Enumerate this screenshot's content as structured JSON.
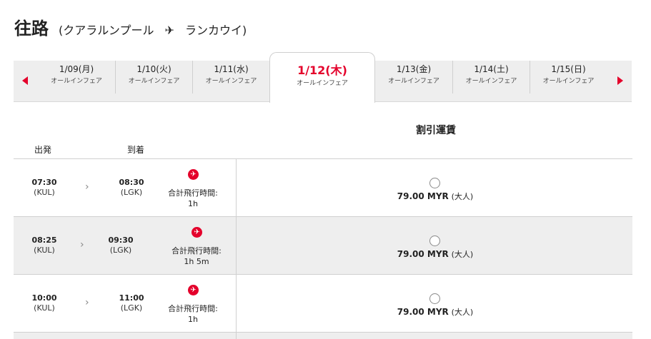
{
  "header": {
    "title": "往路",
    "route_open": "(クアラルンプール",
    "plane_glyph": "✈",
    "route_close": "ランカウイ)"
  },
  "dates": [
    {
      "date": "1/09(月)",
      "fare": "オールインフェア"
    },
    {
      "date": "1/10(火)",
      "fare": "オールインフェア"
    },
    {
      "date": "1/11(水)",
      "fare": "オールインフェア"
    },
    {
      "date": "1/12(木)",
      "fare": "オールインフェア"
    },
    {
      "date": "1/13(金)",
      "fare": "オールインフェア"
    },
    {
      "date": "1/14(土)",
      "fare": "オールインフェア"
    },
    {
      "date": "1/15(日)",
      "fare": "オールインフェア"
    }
  ],
  "columns": {
    "depart": "出発",
    "arrive": "到着",
    "fare_class": "割引運賃"
  },
  "flights": [
    {
      "dep_time": "07:30",
      "dep_code": "(KUL)",
      "arr_time": "08:30",
      "arr_code": "(LGK)",
      "duration_label": "合計飛行時間:",
      "duration": "1h",
      "price": "79.00 MYR",
      "pax": "(大人)"
    },
    {
      "dep_time": "08:25",
      "dep_code": "(KUL)",
      "arr_time": "09:30",
      "arr_code": "(LGK)",
      "duration_label": "合計飛行時間:",
      "duration": "1h 5m",
      "price": "79.00 MYR",
      "pax": "(大人)"
    },
    {
      "dep_time": "10:00",
      "dep_code": "(KUL)",
      "arr_time": "11:00",
      "arr_code": "(LGK)",
      "duration_label": "合計飛行時間:",
      "duration": "1h",
      "price": "79.00 MYR",
      "pax": "(大人)"
    }
  ],
  "icons": {
    "prev": "caret-left-icon",
    "next": "caret-right-icon",
    "airline": "airasia-plane-icon"
  },
  "colors": {
    "accent": "#e4002b",
    "tab_bar": "#eeeeee",
    "alt_row": "#eeeeee"
  }
}
